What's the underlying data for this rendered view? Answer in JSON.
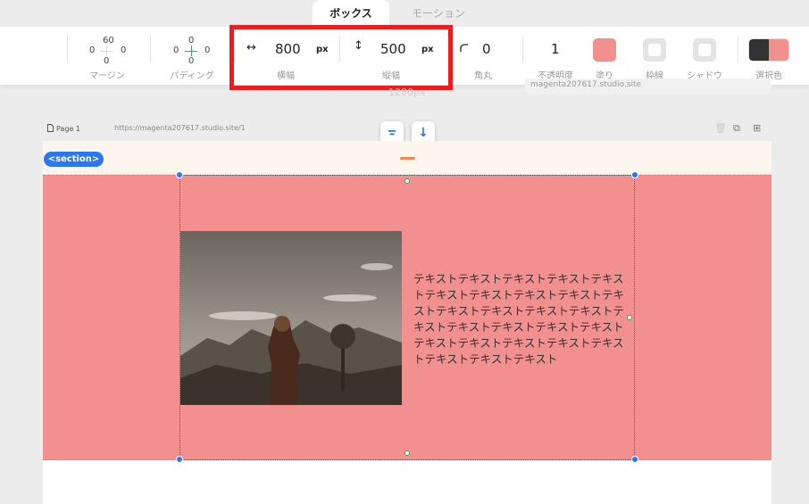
{
  "tabs": {
    "active": "ボックス",
    "inactive": "モーション"
  },
  "toolbar": {
    "margin": {
      "label": "マージン",
      "top": "60",
      "left": "0",
      "right": "0",
      "bottom": "0"
    },
    "padding": {
      "label": "パディング",
      "left": "0",
      "right": "0",
      "top": "0",
      "bottom": "0"
    },
    "width": {
      "label": "横幅",
      "value": "800",
      "unit": "px"
    },
    "height": {
      "label": "縦幅",
      "value": "500",
      "unit": "px"
    },
    "radius": {
      "label": "角丸",
      "value": "0"
    },
    "opacity": {
      "label": "不透明度",
      "value": "1"
    },
    "fill": {
      "label": "塗り",
      "color": "#f28f8f"
    },
    "border": {
      "label": "枠線"
    },
    "shadow": {
      "label": "シャドウ"
    },
    "selection_color": {
      "label": "選択色",
      "colors": [
        "#333333",
        "#f28f8f"
      ]
    }
  },
  "ruler_label": "1280px",
  "site_url_hint": "magenta207617.studio.site",
  "pagebar": {
    "page": "Page 1",
    "url": "https://magenta207617.studio.site/1"
  },
  "section_tag": "<section>",
  "content": {
    "body_text": "テキストテキストテキストテキストテキストテキストテキストテキストテキストテキストテキストテキストテキストテキストテキストテキストテキストテキストテキストテキストテキストテキストテキストテキストテキストテキストテキスト"
  },
  "colors": {
    "accent": "#2b77f0",
    "section_bg": "#f28f8f",
    "highlight_box": "#ee1c1c",
    "handle": "#f08a4b"
  }
}
